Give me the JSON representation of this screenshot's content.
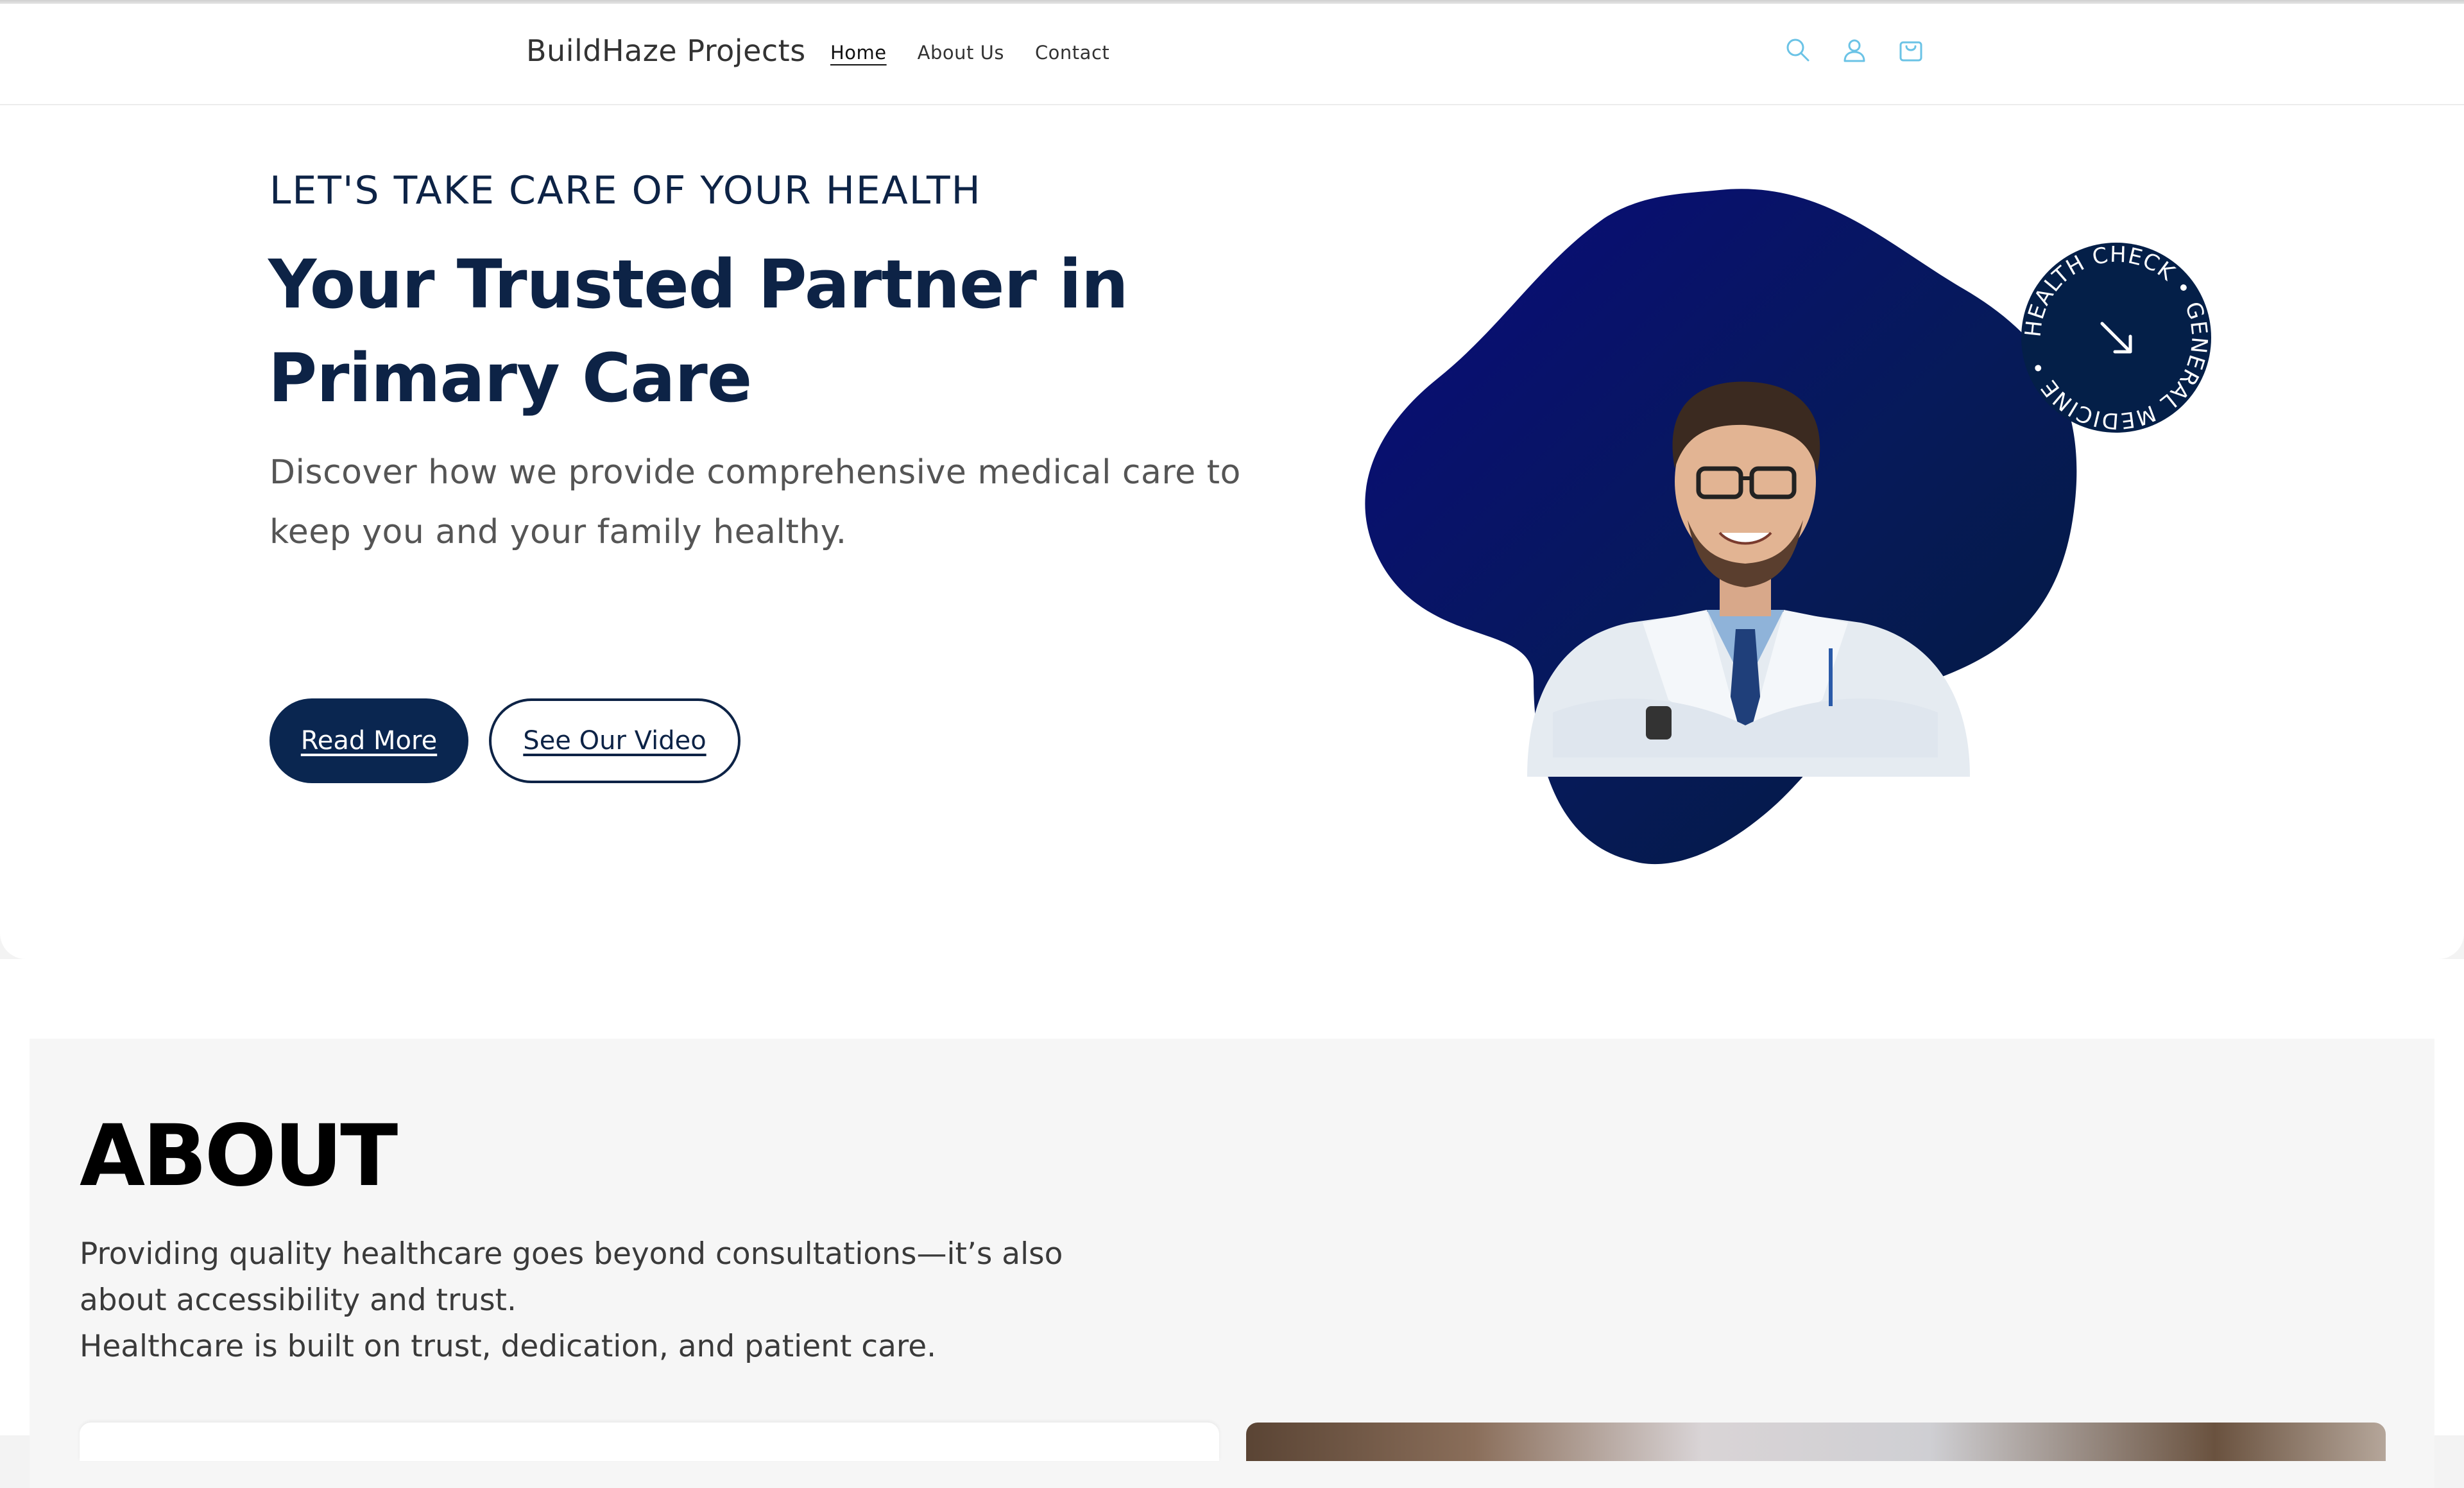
{
  "header": {
    "brand": "BuildHaze Projects",
    "nav": [
      {
        "label": "Home",
        "active": true
      },
      {
        "label": "About Us",
        "active": false
      },
      {
        "label": "Contact",
        "active": false
      }
    ],
    "icons": [
      "search-icon",
      "account-icon",
      "cart-icon"
    ],
    "icon_color": "#6bc3e6"
  },
  "hero": {
    "eyebrow": "LET'S TAKE CARE OF YOUR HEALTH",
    "title": "Your Trusted Partner in Primary Care",
    "lede": "Discover how we provide comprehensive medical care to keep you and your family healthy.",
    "primary_button": "Read More",
    "secondary_button": "See Our Video",
    "badge_text": "HEALTH CHECK • GENERAL MEDICINE •",
    "brand_color": "#0a2650"
  },
  "about": {
    "title": "ABOUT",
    "paragraph1": "Providing quality healthcare goes beyond consultations—it’s also about accessibility and trust.",
    "paragraph2": "Healthcare is built on trust, dedication, and patient care."
  }
}
